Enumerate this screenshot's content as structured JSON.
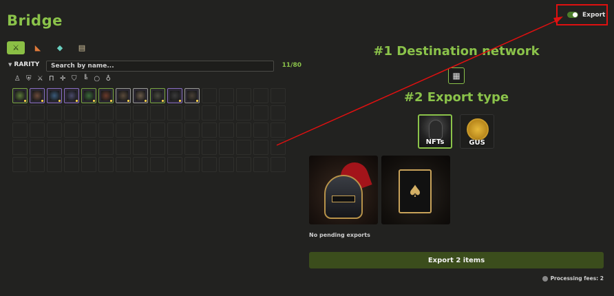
{
  "app": {
    "title": "Bridge"
  },
  "category_tabs": [
    {
      "name": "weapons-icon",
      "glyph": "⚔"
    },
    {
      "name": "axe-icon",
      "glyph": "◣"
    },
    {
      "name": "gem-icon",
      "glyph": "◆"
    },
    {
      "name": "scroll-icon",
      "glyph": "▤"
    }
  ],
  "filters": {
    "rarity_label": "RARITY",
    "search_placeholder": "Search by name...",
    "count": "11/80"
  },
  "slot_filters": [
    {
      "name": "helmet-icon",
      "glyph": "♙"
    },
    {
      "name": "armor-icon",
      "glyph": "⛨"
    },
    {
      "name": "sword-icon",
      "glyph": "⚔"
    },
    {
      "name": "pants-icon",
      "glyph": "Π"
    },
    {
      "name": "cross-icon",
      "glyph": "✛"
    },
    {
      "name": "shield-icon",
      "glyph": "⛉"
    },
    {
      "name": "boots-icon",
      "glyph": "╚"
    },
    {
      "name": "ring-icon",
      "glyph": "○"
    },
    {
      "name": "amulet-icon",
      "glyph": "♁"
    }
  ],
  "inventory": [
    {
      "name": "shield-item",
      "color": "#5c7a3a"
    },
    {
      "name": "armor-item",
      "color": "#6a4a3a"
    },
    {
      "name": "dagger-item",
      "color": "#3a5a7a"
    },
    {
      "name": "orb-item",
      "color": "#4a4a6a"
    },
    {
      "name": "emerald-item",
      "color": "#3a6a3a"
    },
    {
      "name": "helm-item",
      "color": "#6a3a2a"
    },
    {
      "name": "bow-item",
      "color": "#5a4a3a"
    },
    {
      "name": "staff-item",
      "color": "#6a5a4a"
    },
    {
      "name": "knight-item",
      "color": "#4a4a40"
    },
    {
      "name": "wand-item",
      "color": "#3a3a3a"
    },
    {
      "name": "bow2-item",
      "color": "#4a4036"
    }
  ],
  "export_toggle": {
    "label": "Export",
    "on": true
  },
  "destination": {
    "heading": "#1 Destination network",
    "network_icon": "chip-icon"
  },
  "export_type": {
    "heading": "#2 Export type",
    "options": [
      {
        "label": "NFTs",
        "selected": true
      },
      {
        "label": "GUS",
        "selected": false
      }
    ]
  },
  "previews": [
    {
      "name": "helmet-nft"
    },
    {
      "name": "card-nft",
      "glyph": "♠"
    }
  ],
  "status": {
    "no_pending": "No pending exports"
  },
  "actions": {
    "export_label": "Export 2 items"
  },
  "fees": {
    "label": "Processing fees: 2"
  },
  "colors": {
    "accent": "#8bc34a",
    "background": "#222220",
    "button": "#3b4d1c",
    "annotation": "#e01010"
  }
}
